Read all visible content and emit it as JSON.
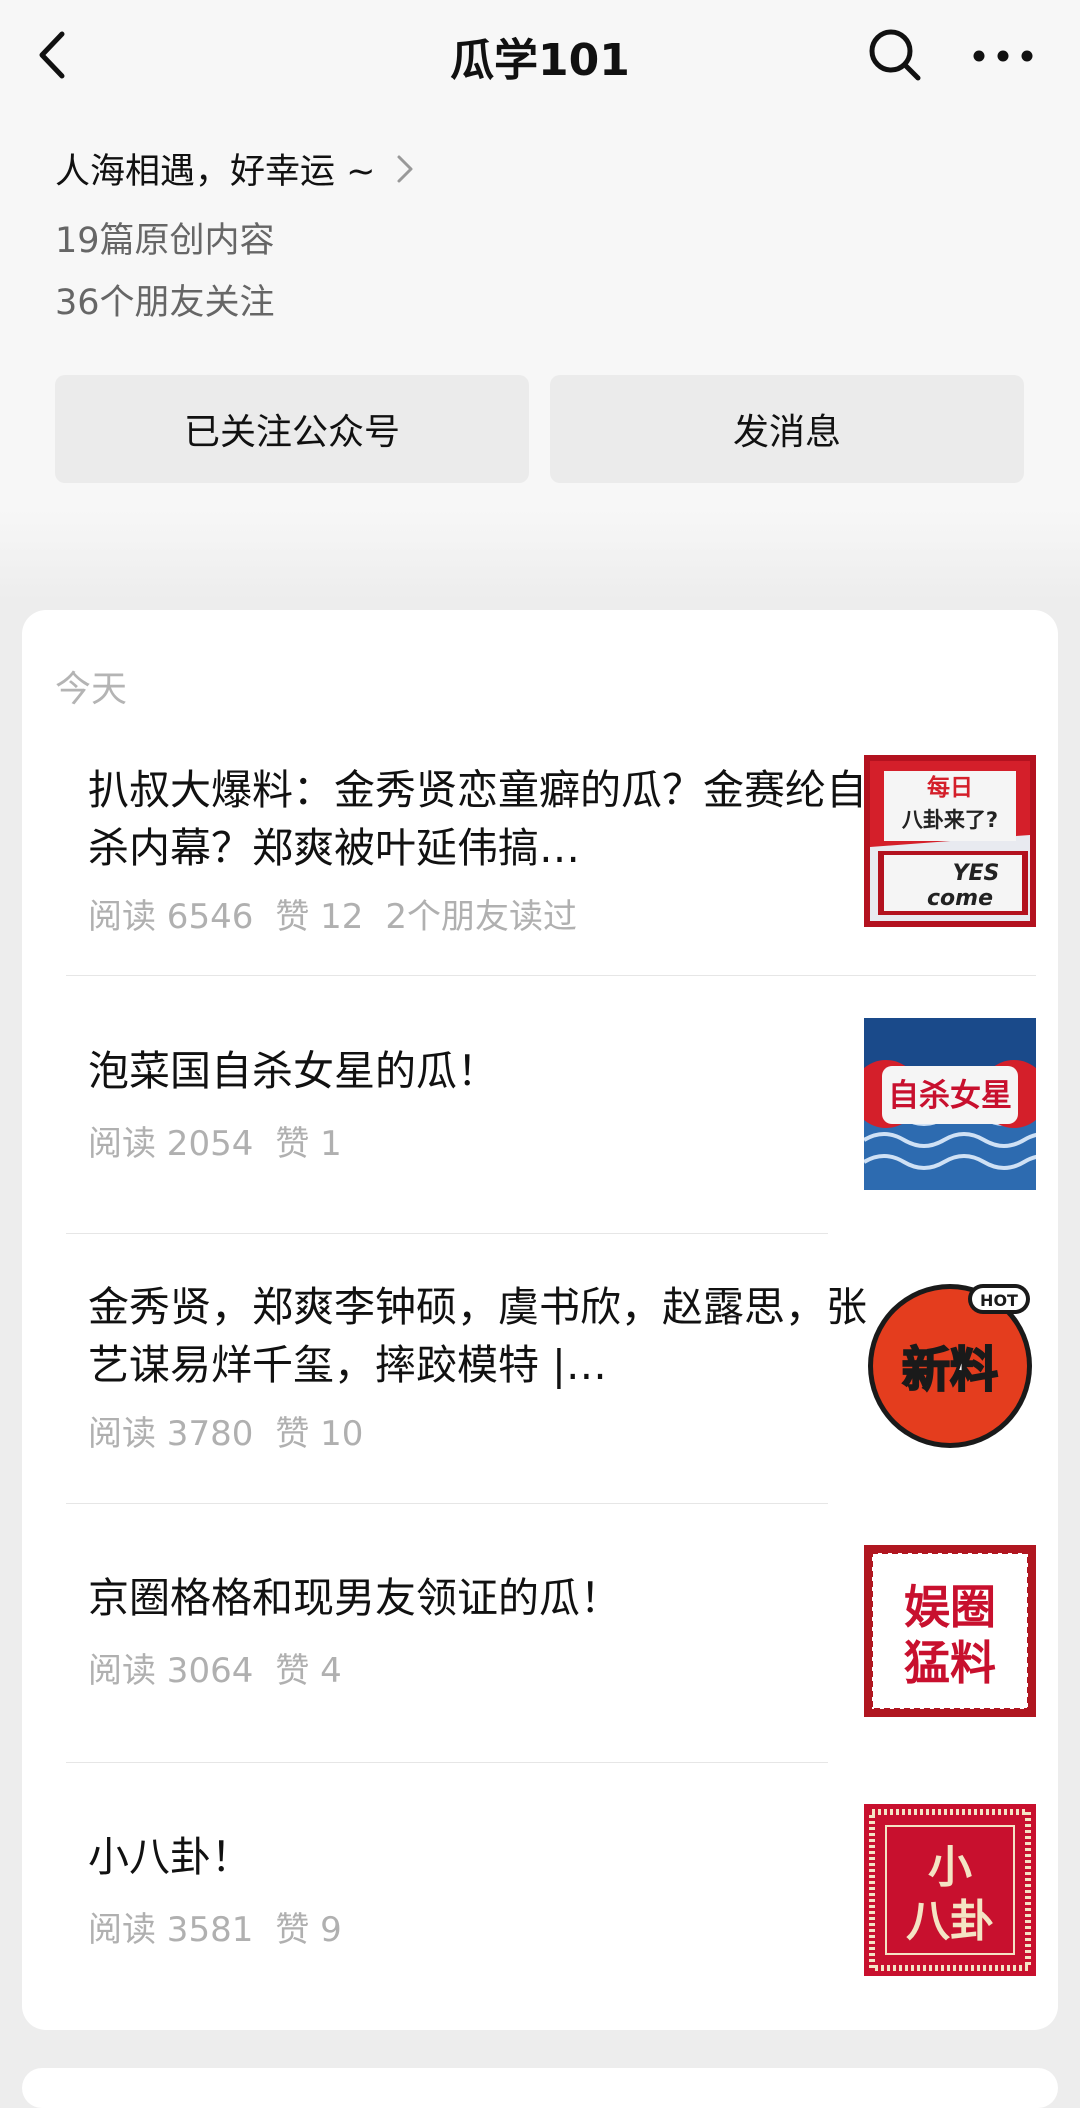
{
  "header": {
    "title": "瓜学101"
  },
  "profile": {
    "intro": "人海相遇，好幸运 ~",
    "original_count": "19篇原创内容",
    "friends_following": "36个朋友关注"
  },
  "actions": {
    "follow_label": "已关注公众号",
    "message_label": "发消息"
  },
  "feed": {
    "date_label": "今天",
    "articles": [
      {
        "title": "扒叔大爆料：金秀贤恋童癖的瓜？金赛纶自杀内幕？郑爽被叶延伟搞…",
        "reads": "阅读 6546",
        "likes": "赞 12",
        "friends": "2个朋友读过",
        "thumb_text": [
          "每日",
          "八卦来了?",
          "YES",
          "come"
        ]
      },
      {
        "title": "泡菜国自杀女星的瓜！",
        "reads": "阅读 2054",
        "likes": "赞 1",
        "thumb_text": [
          "自杀女星"
        ]
      },
      {
        "title": "金秀贤，郑爽李钟硕，虞书欣，赵露思，张艺谋易烊千玺，摔跤模特 |…",
        "reads": "阅读 3780",
        "likes": "赞 10",
        "thumb_text": [
          "HOT",
          "新料"
        ]
      },
      {
        "title": "京圈格格和现男友领证的瓜！",
        "reads": "阅读 3064",
        "likes": "赞 4",
        "thumb_text": [
          "娱圈",
          "猛料"
        ]
      },
      {
        "title": "小八卦！",
        "reads": "阅读 3581",
        "likes": "赞 9",
        "thumb_text": [
          "小",
          "八卦"
        ]
      }
    ]
  },
  "colors": {
    "accent_red": "#c8102e",
    "muted_text": "#b0b0b0",
    "button_bg": "#ebebeb"
  }
}
